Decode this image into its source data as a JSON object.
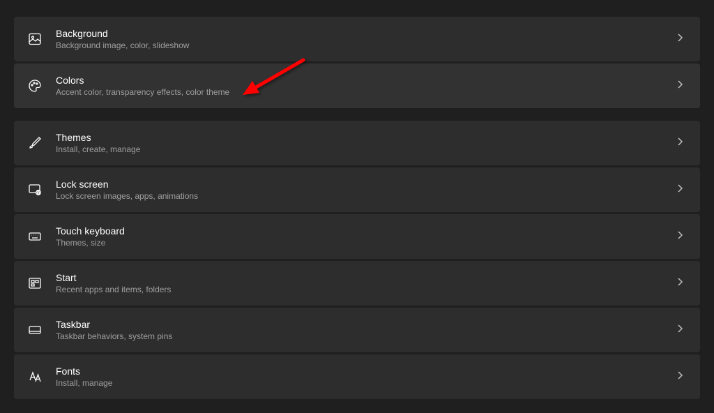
{
  "settings": [
    {
      "id": "background",
      "title": "Background",
      "desc": "Background image, color, slideshow",
      "icon": "image"
    },
    {
      "id": "colors",
      "title": "Colors",
      "desc": "Accent color, transparency effects, color theme",
      "icon": "palette",
      "highlight": true
    },
    {
      "id": "themes",
      "title": "Themes",
      "desc": "Install, create, manage",
      "icon": "brush"
    },
    {
      "id": "lockscreen",
      "title": "Lock screen",
      "desc": "Lock screen images, apps, animations",
      "icon": "lockscreen"
    },
    {
      "id": "touchkeyboard",
      "title": "Touch keyboard",
      "desc": "Themes, size",
      "icon": "keyboard"
    },
    {
      "id": "start",
      "title": "Start",
      "desc": "Recent apps and items, folders",
      "icon": "start"
    },
    {
      "id": "taskbar",
      "title": "Taskbar",
      "desc": "Taskbar behaviors, system pins",
      "icon": "taskbar"
    },
    {
      "id": "fonts",
      "title": "Fonts",
      "desc": "Install, manage",
      "icon": "fonts"
    }
  ],
  "annotation": {
    "color": "#ff0000"
  }
}
